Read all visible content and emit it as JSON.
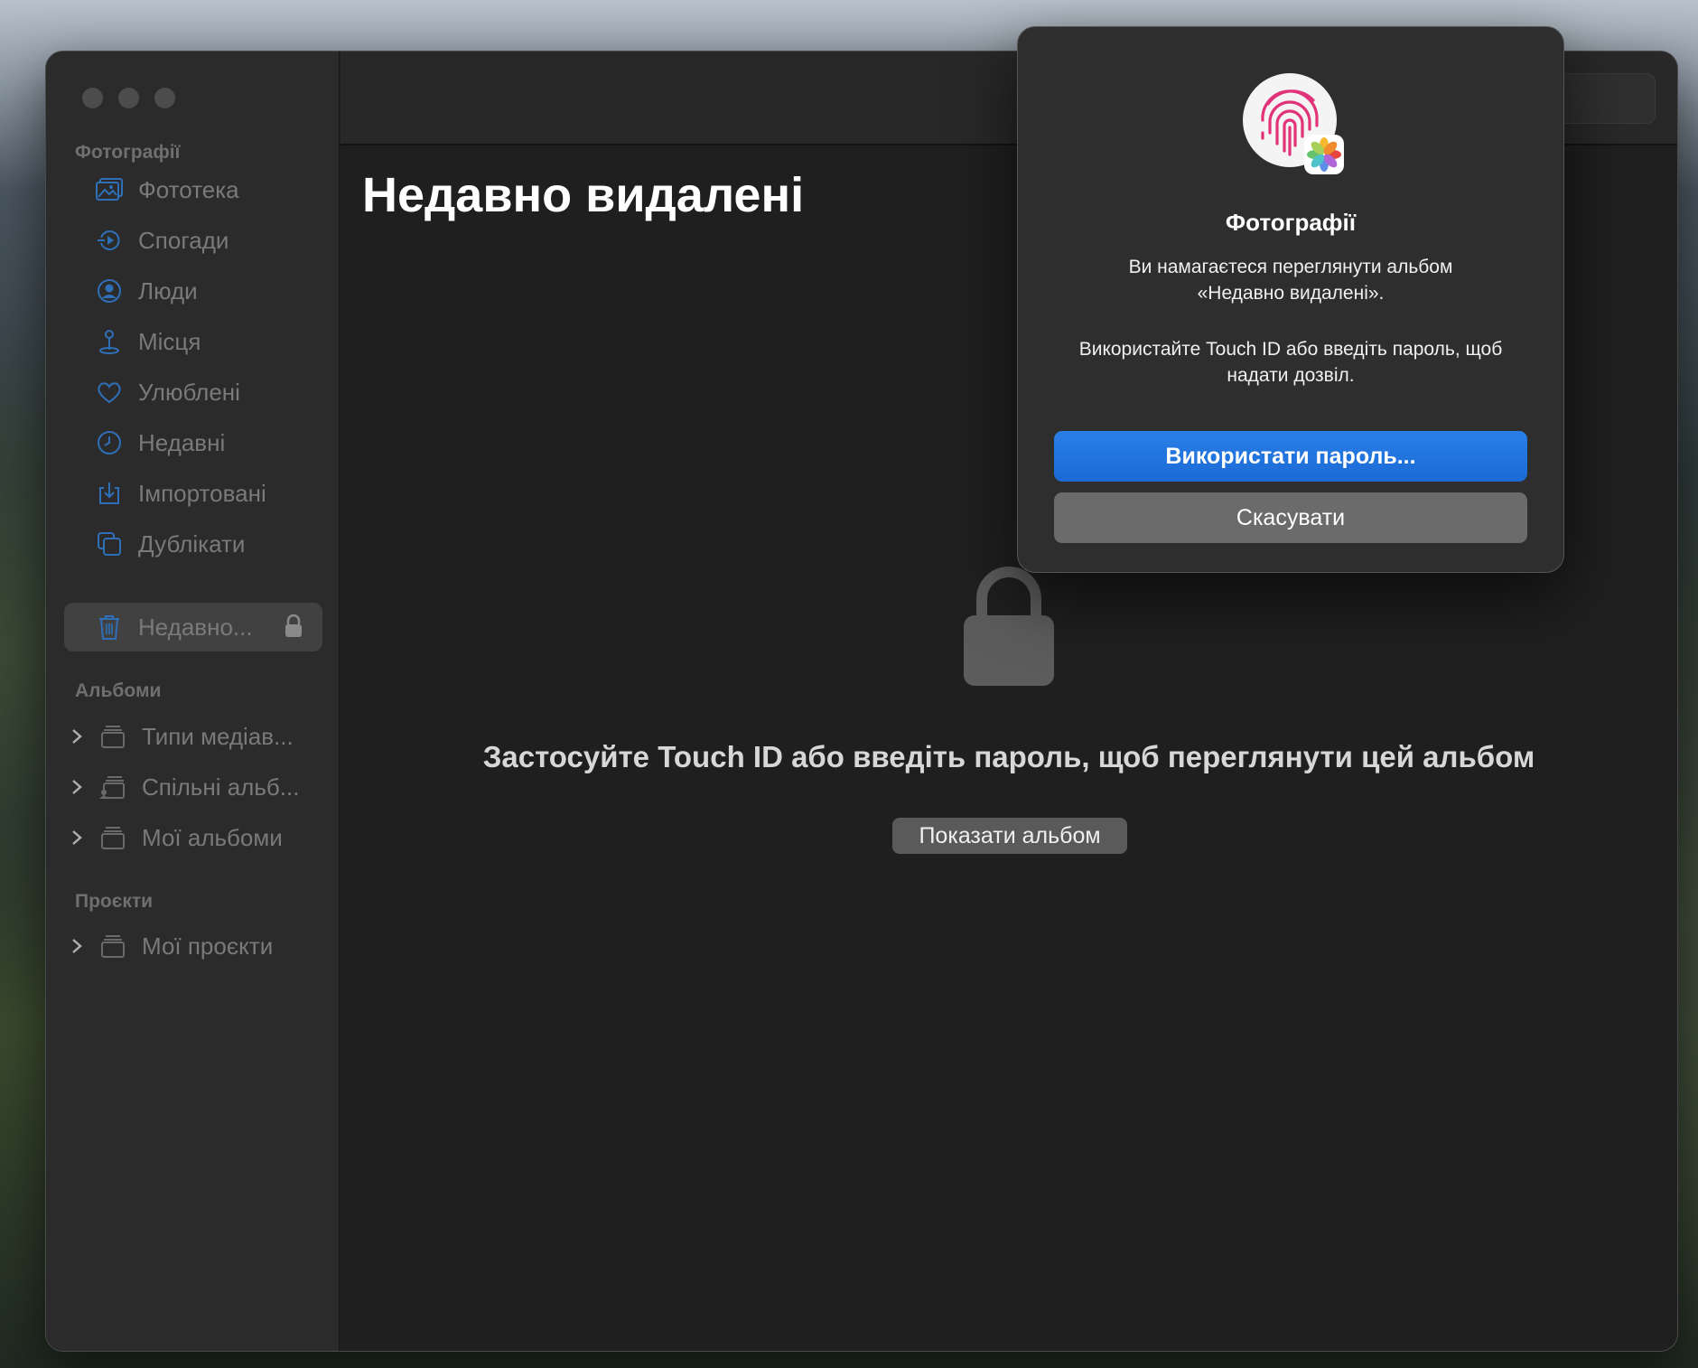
{
  "sidebar": {
    "section_photos": "Фотографії",
    "items": [
      {
        "label": "Фототека",
        "icon": "photo-library-icon"
      },
      {
        "label": "Спогади",
        "icon": "memories-icon"
      },
      {
        "label": "Люди",
        "icon": "people-icon"
      },
      {
        "label": "Місця",
        "icon": "places-pin-icon"
      },
      {
        "label": "Улюблені",
        "icon": "heart-icon"
      },
      {
        "label": "Недавні",
        "icon": "clock-icon"
      },
      {
        "label": "Імпортовані",
        "icon": "import-icon"
      },
      {
        "label": "Дублікати",
        "icon": "duplicates-icon"
      },
      {
        "label": "Недавно...",
        "icon": "trash-icon",
        "selected": true,
        "locked": true
      }
    ],
    "section_albums": "Альбоми",
    "albums": [
      {
        "label": "Типи медіав...",
        "icon": "album-stack-icon"
      },
      {
        "label": "Спільні альб...",
        "icon": "shared-album-icon"
      },
      {
        "label": "Мої альбоми",
        "icon": "album-stack-icon"
      }
    ],
    "section_projects": "Проєкти",
    "projects": [
      {
        "label": "Мої проєкти",
        "icon": "album-stack-icon"
      }
    ]
  },
  "main": {
    "title": "Недавно видалені",
    "locked_message": "Застосуйте Touch ID або введіть пароль, щоб переглянути цей альбом",
    "show_button": "Показати альбом"
  },
  "dialog": {
    "app_name": "Фотографії",
    "message_line1": "Ви намагаєтеся переглянути альбом",
    "message_line2": "«Недавно видалені».",
    "instruction_line1": "Використайте Touch ID або введіть пароль, щоб",
    "instruction_line2": "надати дозвіл.",
    "primary_button": "Використати пароль...",
    "cancel_button": "Скасувати"
  },
  "colors": {
    "accent": "#1b6ad6",
    "sidebar_icon": "#2f6fb8",
    "window_bg": "#1f1f1f",
    "sidebar_bg": "#2b2b2b"
  }
}
